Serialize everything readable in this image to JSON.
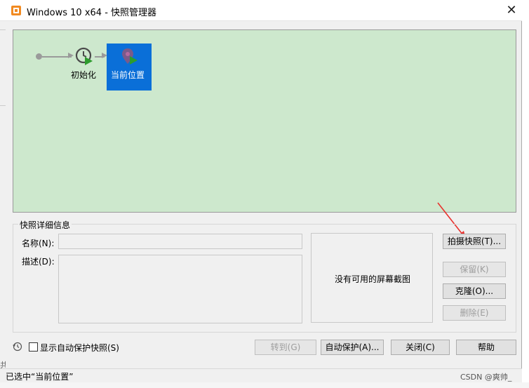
{
  "window": {
    "title": "Windows 10 x64 - 快照管理器",
    "close_glyph": "✕"
  },
  "tree": {
    "nodes": [
      {
        "label": "初始化",
        "icon": "clock-play-icon"
      },
      {
        "label": "当前位置",
        "icon": "location-pin-play-icon",
        "selected": true
      }
    ]
  },
  "details": {
    "legend": "快照详细信息",
    "name_label": "名称(N):",
    "name_value": "",
    "desc_label": "描述(D):",
    "desc_value": "",
    "no_screenshot": "没有可用的屏幕截图"
  },
  "actions": {
    "take": "拍摄快照(T)...",
    "keep": "保留(K)",
    "clone": "克隆(O)...",
    "delete": "删除(E)"
  },
  "footer": {
    "auto_show_label": "显示自动保护快照(S)",
    "goto": "转到(G)",
    "autoprotect": "自动保护(A)...",
    "close": "关闭(C)",
    "help": "帮助"
  },
  "status": {
    "text": "已选中“当前位置”"
  },
  "background": {
    "edge_text": "共",
    "watermark": "CSDN @爽帅_"
  },
  "colors": {
    "tree_bg": "#cde8cd",
    "selection": "#0a6fd8",
    "annotation": "#e8322e"
  }
}
